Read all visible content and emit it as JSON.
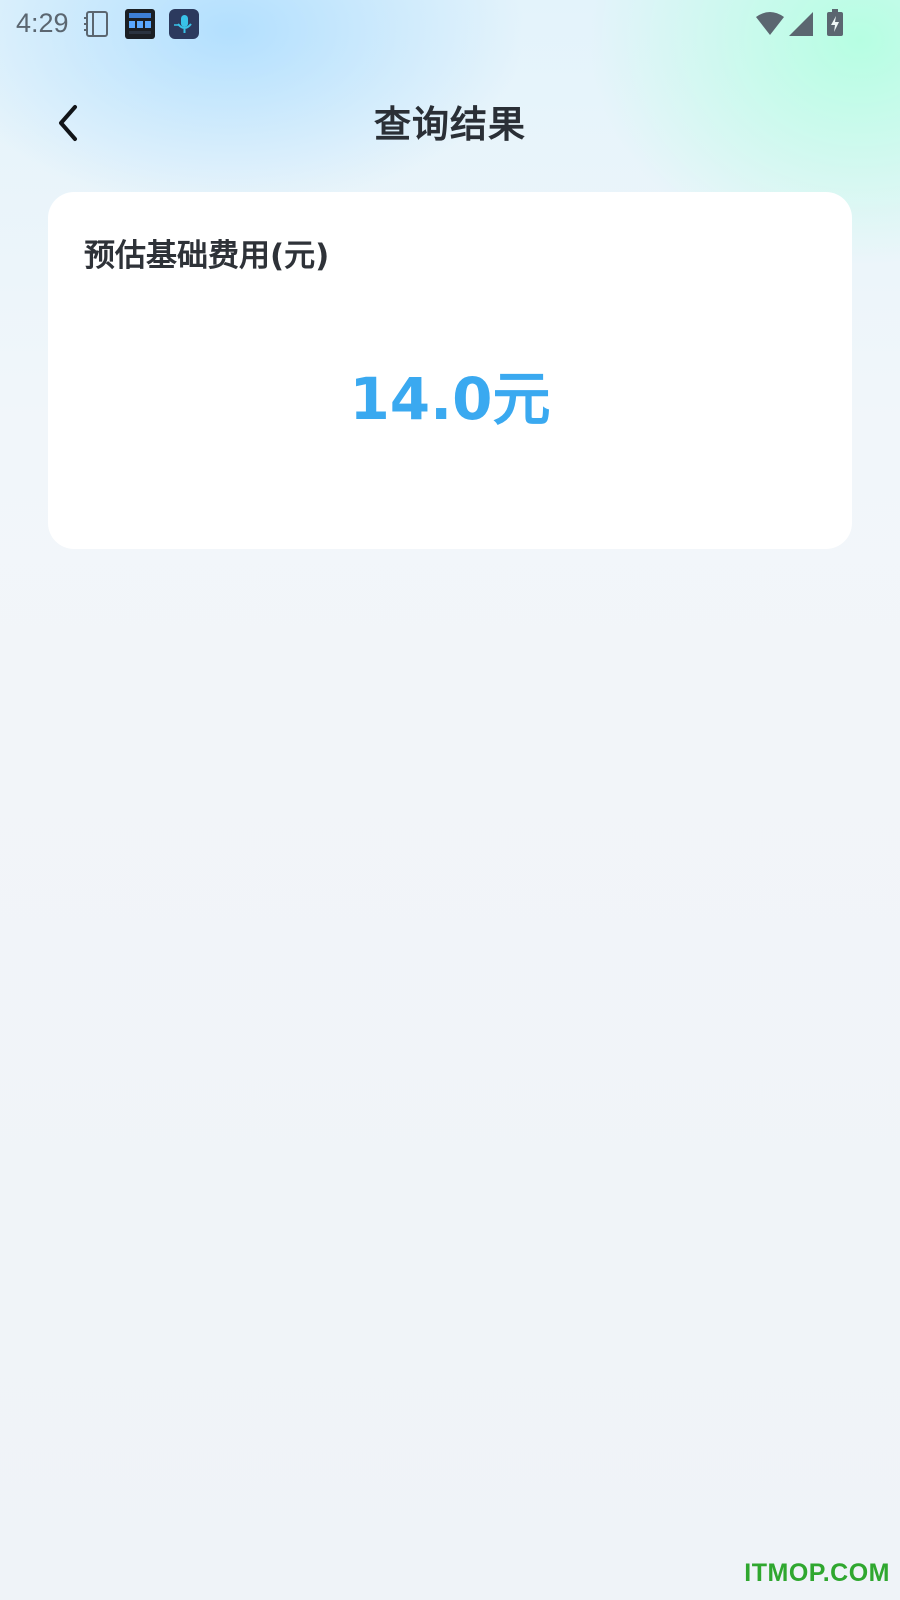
{
  "status_bar": {
    "time": "4:29",
    "icons": [
      "notebook-icon",
      "clock-app-icon",
      "mic-app-icon",
      "wifi-icon",
      "signal-icon",
      "battery-charging-icon"
    ]
  },
  "header": {
    "back_icon": "chevron-left-icon",
    "title": "查询结果"
  },
  "result_card": {
    "label": "预估基础费用(元)",
    "value": "14.0元"
  },
  "watermark": "ITMOP.COM",
  "colors": {
    "accent_value": "#3aa9f0",
    "title_text": "#2a2f36",
    "watermark": "#2fa72f",
    "card_bg": "#ffffff",
    "page_bg": "#eff3f8"
  }
}
